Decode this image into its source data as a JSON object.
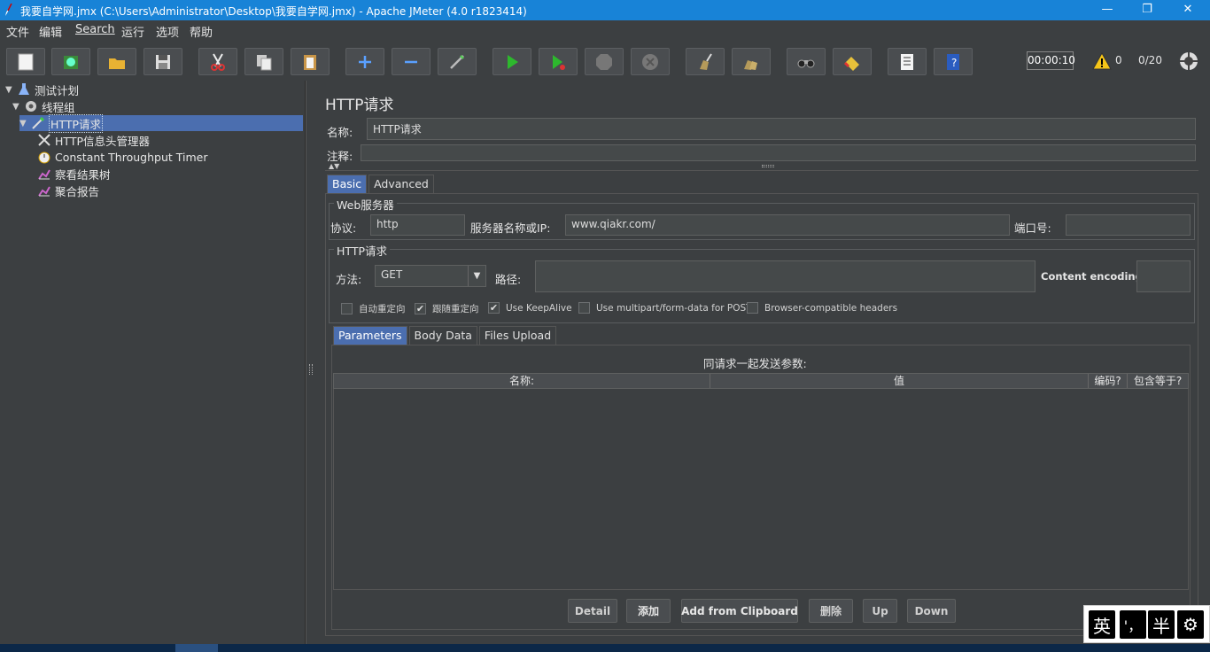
{
  "window": {
    "title": "我要自学网.jmx (C:\\Users\\Administrator\\Desktop\\我要自学网.jmx) - Apache JMeter (4.0 r1823414)",
    "minimize": "—",
    "restore": "❐",
    "close": "✕"
  },
  "menu": {
    "items": [
      "文件",
      "编辑",
      "Search",
      "运行",
      "选项",
      "帮助"
    ]
  },
  "toolbar": {
    "timer": "00:00:10",
    "warning_count": "0",
    "thread_count": "0/20",
    "accent": "#4b6eaf"
  },
  "tree": {
    "nodes": [
      {
        "label": "测试计划",
        "icon": "flask-icon"
      },
      {
        "label": "线程组",
        "icon": "gear-icon"
      },
      {
        "label": "HTTP请求",
        "icon": "pipette-icon"
      },
      {
        "label": "HTTP信息头管理器",
        "icon": "tools-icon"
      },
      {
        "label": "Constant Throughput Timer",
        "icon": "stopwatch-icon"
      },
      {
        "label": "察看结果树",
        "icon": "chart-icon"
      },
      {
        "label": "聚合报告",
        "icon": "chart-icon"
      }
    ]
  },
  "panel": {
    "title": "HTTP请求",
    "name_label": "名称:",
    "name_value": "HTTP请求",
    "comment_label": "注释:",
    "comment_value": "",
    "tabs": [
      "Basic",
      "Advanced"
    ],
    "web_server": {
      "legend": "Web服务器",
      "protocol_label": "协议:",
      "protocol_value": "http",
      "server_label": "服务器名称或IP:",
      "server_value": "www.qiakr.com/",
      "port_label": "端口号:",
      "port_value": ""
    },
    "http_request": {
      "legend": "HTTP请求",
      "method_label": "方法:",
      "method_value": "GET",
      "path_label": "路径:",
      "path_value": "",
      "encoding_label": "Content encoding:",
      "encoding_value": ""
    },
    "checkboxes": [
      {
        "label": "自动重定向",
        "checked": false
      },
      {
        "label": "跟随重定向",
        "checked": true
      },
      {
        "label": "Use KeepAlive",
        "checked": true
      },
      {
        "label": "Use multipart/form-data for POST",
        "checked": false
      },
      {
        "label": "Browser-compatible headers",
        "checked": false
      }
    ],
    "subtabs": [
      "Parameters",
      "Body Data",
      "Files Upload"
    ],
    "params_caption": "同请求一起发送参数:",
    "columns": [
      "名称:",
      "值",
      "编码?",
      "包含等于?"
    ],
    "buttons": [
      "Detail",
      "添加",
      "Add from Clipboard",
      "删除",
      "Up",
      "Down"
    ]
  },
  "ime": {
    "items": [
      "英",
      "'，",
      "半",
      "⚙"
    ]
  }
}
